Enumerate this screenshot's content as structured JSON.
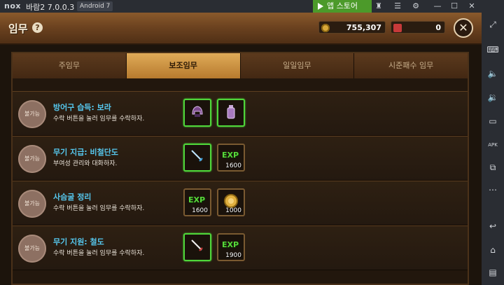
{
  "emulator": {
    "logo": "nox",
    "title": "바람2 7.0.0.3",
    "android": "Android 7",
    "store": "앱 스토어",
    "controls": [
      "♜",
      "☰",
      "⚙",
      "—",
      "☐",
      "✕"
    ]
  },
  "window": {
    "title": "임무",
    "help": "?",
    "gold": "755,307",
    "gems": "0",
    "close": "✕"
  },
  "tabs": [
    {
      "label": "주임무",
      "active": false
    },
    {
      "label": "보조임무",
      "active": true
    },
    {
      "label": "일일임무",
      "active": false
    },
    {
      "label": "시준패수 임무",
      "active": false
    }
  ],
  "quests": [
    {
      "badge": "불가능",
      "title": "방어구 습득: 보라",
      "desc": "수락 버튼을 눌러 임무를 수락하자.",
      "rewards": [
        {
          "icon": "helmet-icon",
          "qty": ""
        },
        {
          "icon": "potion-icon",
          "qty": ""
        }
      ]
    },
    {
      "badge": "불가능",
      "title": "무기 지급: 비철단도",
      "desc": "부여성 관리와 대화하자.",
      "rewards": [
        {
          "icon": "sword-icon",
          "qty": ""
        },
        {
          "icon": "exp-icon",
          "label": "EXP",
          "qty": "1600"
        }
      ]
    },
    {
      "badge": "불가능",
      "title": "사슴굴 정리",
      "desc": "수락 버튼을 눌러 임무를 수락하자.",
      "rewards": [
        {
          "icon": "exp-icon",
          "label": "EXP",
          "qty": "1600"
        },
        {
          "icon": "coin-icon",
          "qty": "1000"
        }
      ]
    },
    {
      "badge": "불가능",
      "title": "무기 지원: 철도",
      "desc": "수락 버튼을 눌러 임무를 수락하자.",
      "rewards": [
        {
          "icon": "sword-icon",
          "qty": ""
        },
        {
          "icon": "exp-icon",
          "label": "EXP",
          "qty": "1900"
        }
      ]
    }
  ],
  "side_toolbar": [
    "⤢",
    "⌨",
    "🔈",
    "🔉",
    "▭",
    "APK",
    "⧉",
    "⋯",
    "↩",
    "⌂",
    "▤"
  ],
  "colors": {
    "accent_green": "#4fd63a",
    "title_blue": "#56c8ef",
    "tab_active": "#e0ab58"
  }
}
